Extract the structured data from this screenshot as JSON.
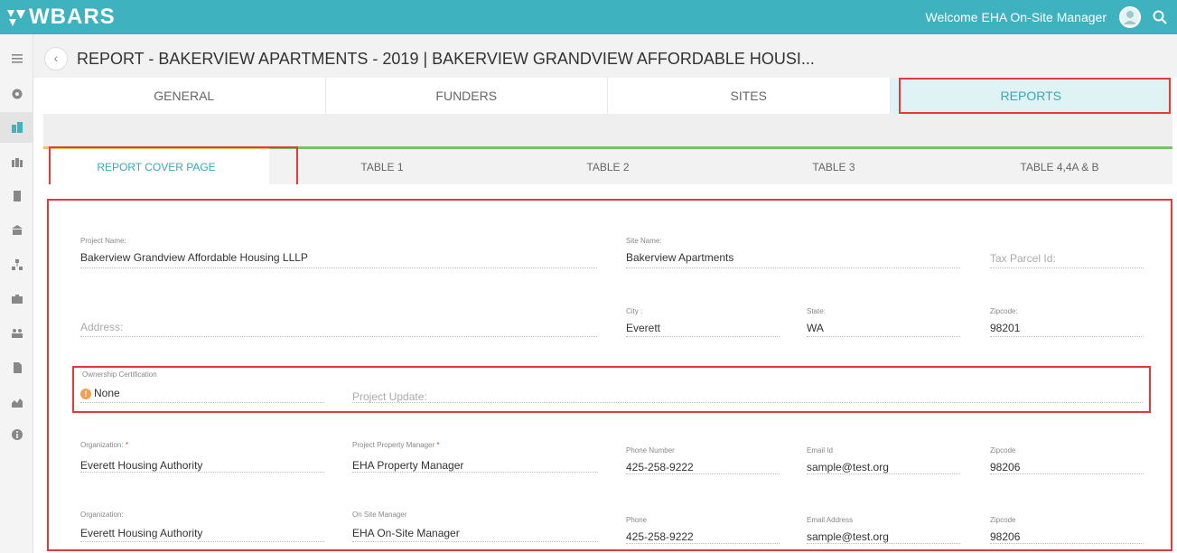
{
  "header": {
    "logo_text": "WBARS",
    "welcome": "Welcome EHA On-Site Manager"
  },
  "breadcrumb": {
    "title": "REPORT - BAKERVIEW APARTMENTS - 2019 | BAKERVIEW GRANDVIEW AFFORDABLE HOUSI..."
  },
  "main_tabs": [
    "GENERAL",
    "FUNDERS",
    "SITES",
    "REPORTS"
  ],
  "sub_tabs": [
    "REPORT COVER PAGE",
    "TABLE 1",
    "TABLE 2",
    "TABLE 3",
    "TABLE 4,4A & B"
  ],
  "form": {
    "project_name": {
      "label": "Project Name:",
      "value": "Bakerview Grandview Affordable Housing LLLP"
    },
    "site_name": {
      "label": "Site Name:",
      "value": "Bakerview Apartments"
    },
    "tax_parcel": {
      "placeholder": "Tax Parcel Id:"
    },
    "address": {
      "placeholder": "Address:"
    },
    "city": {
      "label": "City :",
      "value": "Everett"
    },
    "state": {
      "label": "State:",
      "value": "WA"
    },
    "zipcode1": {
      "label": "Zipcode:",
      "value": "98201"
    },
    "ownership": {
      "label": "Ownership Certification",
      "value": "None"
    },
    "project_update": {
      "placeholder": "Project Update:"
    },
    "organization1": {
      "label": "Organization:",
      "value": "Everett Housing Authority"
    },
    "property_manager": {
      "label": "Project Property Manager",
      "value": "EHA Property Manager"
    },
    "phone_number": {
      "label": "Phone Number",
      "value": "425-258-9222"
    },
    "email_id": {
      "label": "Email Id",
      "value": "sample@test.org"
    },
    "zipcode2": {
      "label": "Zipcode",
      "value": "98206"
    },
    "organization2": {
      "label": "Organization:",
      "value": "Everett Housing Authority"
    },
    "onsite_manager": {
      "label": "On Site Manager",
      "value": "EHA On-Site Manager"
    },
    "phone": {
      "label": "Phone",
      "value": "425-258-9222"
    },
    "email_address": {
      "label": "Email Address",
      "value": "sample@test.org"
    },
    "zipcode3": {
      "label": "Zipcode",
      "value": "98206"
    }
  },
  "colors": {
    "brand": "#3fb2c0",
    "highlight_box": "#e03a3a",
    "active_tab_text": "#3aa9b7"
  },
  "icons": [
    "menu-icon",
    "dashboard-icon",
    "buildings-icon",
    "city-icon",
    "building-icon",
    "bank-icon",
    "org-chart-icon",
    "briefcase-icon",
    "users-icon",
    "document-icon",
    "chart-icon",
    "info-icon"
  ]
}
